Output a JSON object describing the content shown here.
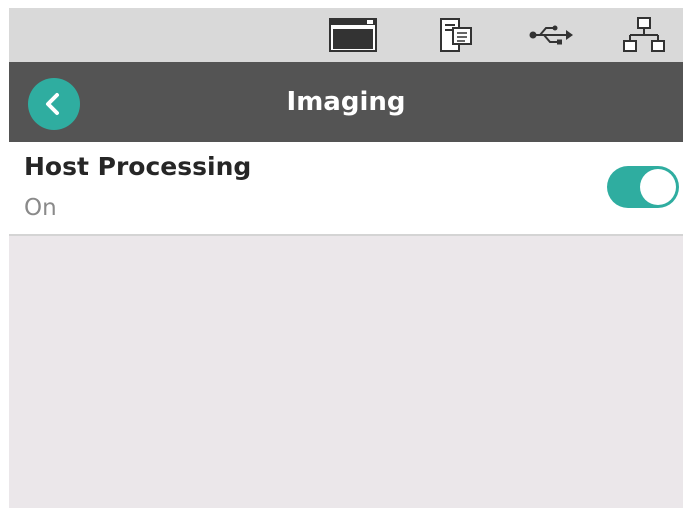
{
  "status_bar": {
    "icons": [
      "scanner-display-icon",
      "document-server-icon",
      "usb-icon",
      "network-icon"
    ]
  },
  "header": {
    "title": "Imaging",
    "back_icon": "chevron-left-icon"
  },
  "setting": {
    "title": "Host Processing",
    "value": "On",
    "toggle_state": true
  },
  "colors": {
    "accent": "#2fada0",
    "header_bg": "#545454",
    "status_bg": "#d9d9d9",
    "content_bg": "#ebe7ea"
  }
}
